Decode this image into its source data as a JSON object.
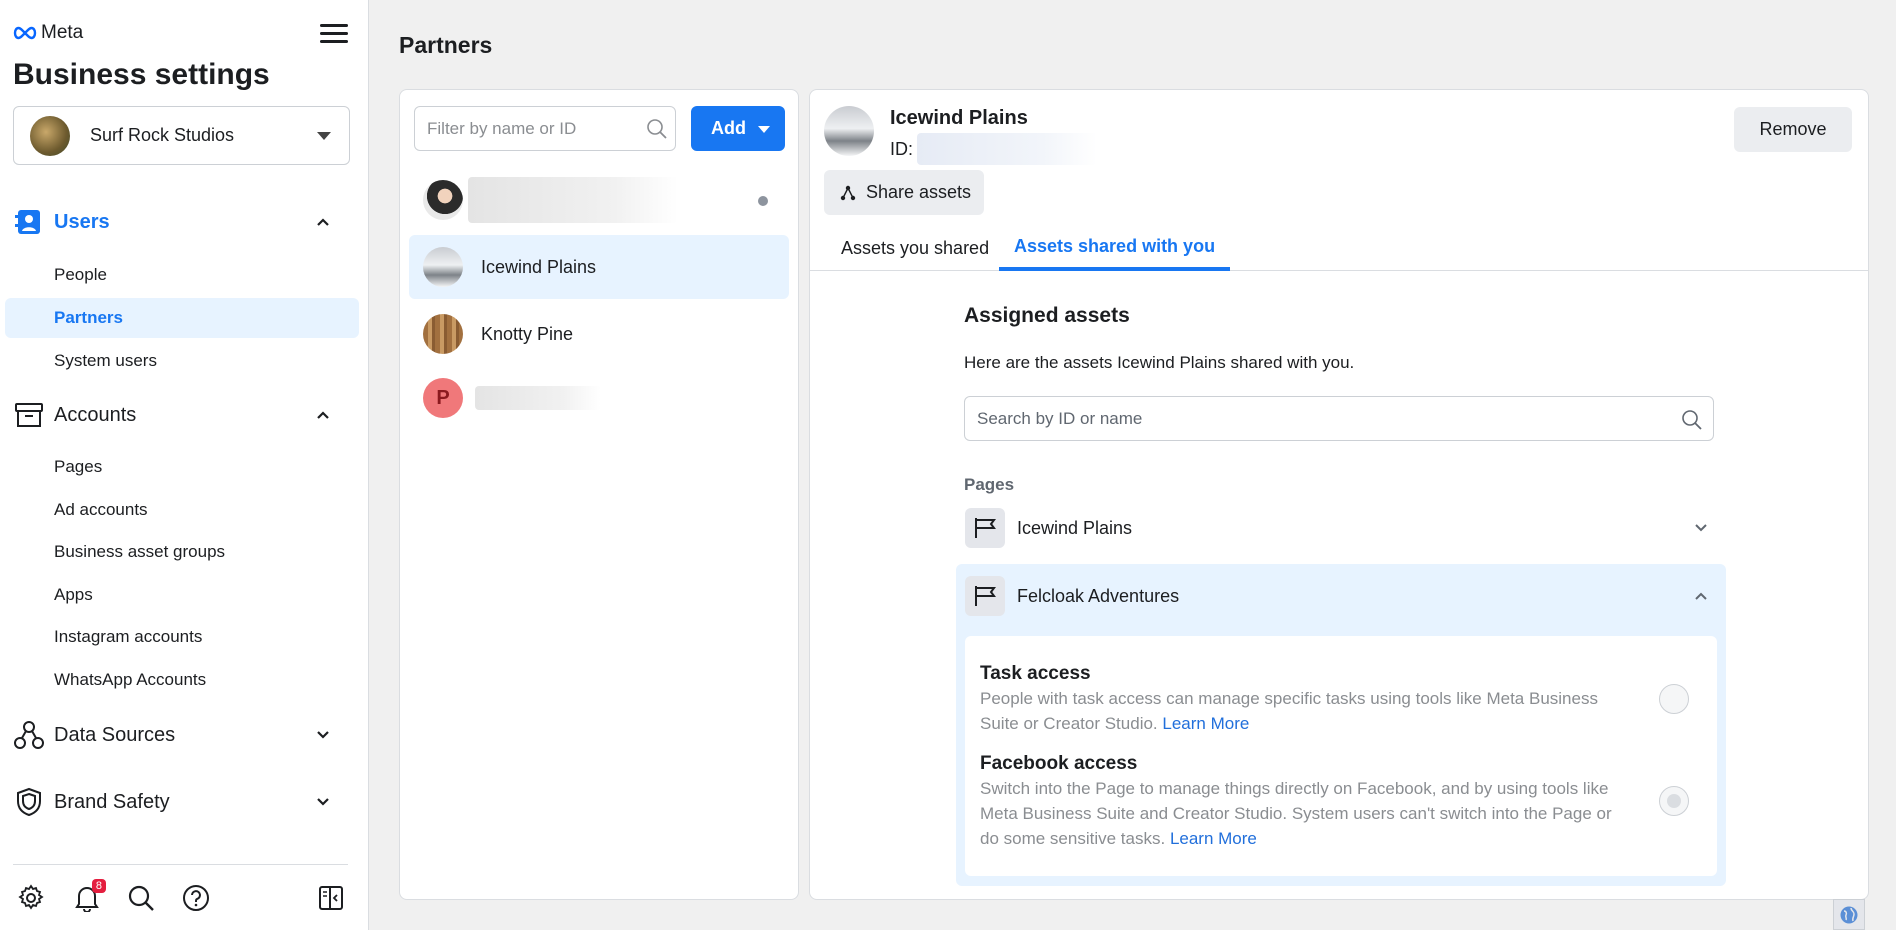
{
  "app": {
    "logo_text": "Meta",
    "title": "Business settings"
  },
  "business_selector": {
    "name": "Surf Rock Studios"
  },
  "sidebar": {
    "sections": [
      {
        "label": "Users",
        "expanded": true,
        "active": true,
        "icon": "users-icon",
        "items": [
          {
            "label": "People"
          },
          {
            "label": "Partners",
            "active": true
          },
          {
            "label": "System users"
          }
        ]
      },
      {
        "label": "Accounts",
        "expanded": true,
        "icon": "accounts-icon",
        "items": [
          {
            "label": "Pages"
          },
          {
            "label": "Ad accounts"
          },
          {
            "label": "Business asset groups"
          },
          {
            "label": "Apps"
          },
          {
            "label": "Instagram accounts"
          },
          {
            "label": "WhatsApp Accounts"
          }
        ]
      },
      {
        "label": "Data Sources",
        "expanded": false,
        "icon": "data-sources-icon"
      },
      {
        "label": "Brand Safety",
        "expanded": false,
        "icon": "shield-icon"
      }
    ],
    "notification_count": "8"
  },
  "page_title": "Partners",
  "partners_list": {
    "filter_placeholder": "Filter by name or ID",
    "add_label": "Add",
    "partners": [
      {
        "name": "",
        "redacted": true
      },
      {
        "name": "Icewind Plains",
        "selected": true
      },
      {
        "name": "Knotty Pine"
      },
      {
        "name": "",
        "redacted": true,
        "initial": "P"
      }
    ]
  },
  "detail": {
    "name": "Icewind Plains",
    "id_label": "ID:",
    "remove_label": "Remove",
    "share_assets_label": "Share assets",
    "tabs": [
      {
        "label": "Assets you shared"
      },
      {
        "label": "Assets shared with you",
        "active": true
      }
    ],
    "assigned_title": "Assigned assets",
    "assigned_desc": "Here are the assets Icewind Plains shared with you.",
    "search_placeholder": "Search by ID or name",
    "pages_label": "Pages",
    "pages": [
      {
        "name": "Icewind Plains",
        "expanded": false
      },
      {
        "name": "Felcloak Adventures",
        "expanded": true
      }
    ],
    "access": {
      "task_title": "Task access",
      "task_desc": "People with task access can manage specific tasks using tools like Meta Business Suite or Creator Studio.",
      "facebook_title": "Facebook access",
      "facebook_desc": "Switch into the Page to manage things directly on Facebook, and by using tools like Meta Business Suite and Creator Studio. System users can't switch into the Page or do some sensitive tasks.",
      "learn_more": "Learn More"
    }
  },
  "colors": {
    "accent": "#1877f2",
    "selected_bg": "#e7f3ff",
    "badge": "#e41e3f"
  }
}
